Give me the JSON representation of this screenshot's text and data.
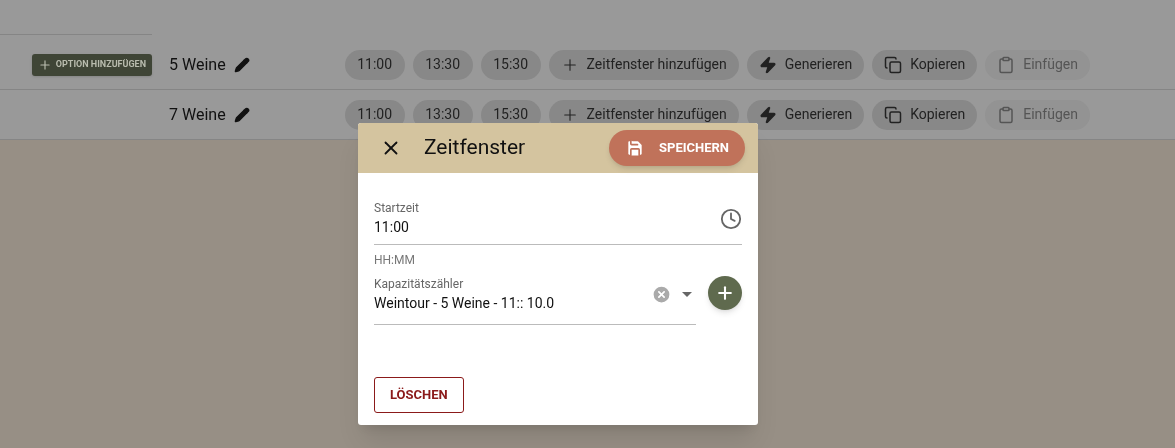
{
  "add_option_button": {
    "label": "OPTION HINZUFÜGEN"
  },
  "rows": [
    {
      "name": "5 Weine",
      "times": [
        "11:00",
        "13:30",
        "15:30"
      ],
      "actions": [
        {
          "kind": "add",
          "label": "Zeitfenster hinzufügen",
          "disabled": false
        },
        {
          "kind": "generate",
          "label": "Generieren",
          "disabled": false
        },
        {
          "kind": "copy",
          "label": "Kopieren",
          "disabled": false
        },
        {
          "kind": "paste",
          "label": "Einfügen",
          "disabled": true
        }
      ]
    },
    {
      "name": "7 Weine",
      "times": [
        "11:00",
        "13:30",
        "15:30"
      ],
      "actions": [
        {
          "kind": "add",
          "label": "Zeitfenster hinzufügen",
          "disabled": false
        },
        {
          "kind": "generate",
          "label": "Generieren",
          "disabled": false
        },
        {
          "kind": "copy",
          "label": "Kopieren",
          "disabled": false
        },
        {
          "kind": "paste",
          "label": "Einfügen",
          "disabled": true
        }
      ]
    }
  ],
  "dialog": {
    "title": "Zeitfenster",
    "save_button": "SPEICHERN",
    "start_time": {
      "label": "Startzeit",
      "value": "11:00",
      "hint": "HH:MM"
    },
    "capacity_counter": {
      "label": "Kapazitätszähler",
      "value": "Weintour - 5 Weine - 11:: 10.0"
    },
    "delete_button": "LÖSCHEN"
  }
}
